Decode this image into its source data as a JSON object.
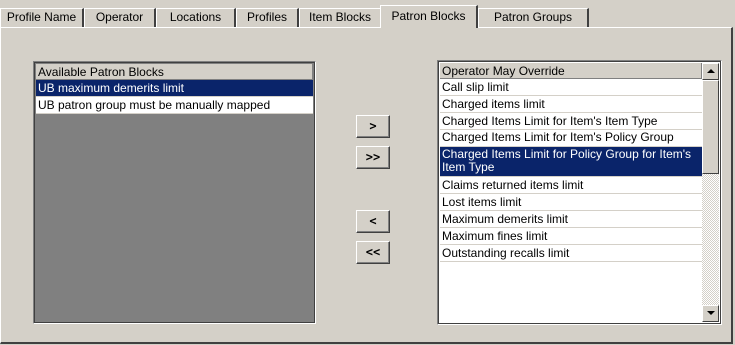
{
  "tabs": [
    {
      "label": "Profile Name"
    },
    {
      "label": "Operator"
    },
    {
      "label": "Locations"
    },
    {
      "label": "Profiles"
    },
    {
      "label": "Item Blocks"
    },
    {
      "label": "Patron Blocks",
      "active": true
    },
    {
      "label": "Patron Groups"
    }
  ],
  "available": {
    "header": "Available Patron Blocks",
    "items": [
      {
        "label": "UB maximum demerits limit",
        "selected": true
      },
      {
        "label": "UB patron group must be manually mapped",
        "selected": false
      }
    ]
  },
  "buttons": {
    "add": ">",
    "add_all": ">>",
    "remove": "<",
    "remove_all": "<<"
  },
  "override": {
    "header": "Operator May Override",
    "items": [
      {
        "label": "Call slip limit"
      },
      {
        "label": "Charged items limit"
      },
      {
        "label": "Charged Items Limit for Item's Item Type"
      },
      {
        "label": "Charged Items Limit for Item's Policy Group"
      },
      {
        "label": "Charged Items Limit for Policy Group for Item's Item Type",
        "selected": true
      },
      {
        "label": "Claims returned items limit"
      },
      {
        "label": "Lost items limit"
      },
      {
        "label": "Maximum demerits limit"
      },
      {
        "label": "Maximum fines limit"
      },
      {
        "label": "Outstanding recalls limit"
      }
    ]
  },
  "colors": {
    "face": "#d4d0c8",
    "selection": "#0a246a",
    "empty_list": "#808080"
  }
}
